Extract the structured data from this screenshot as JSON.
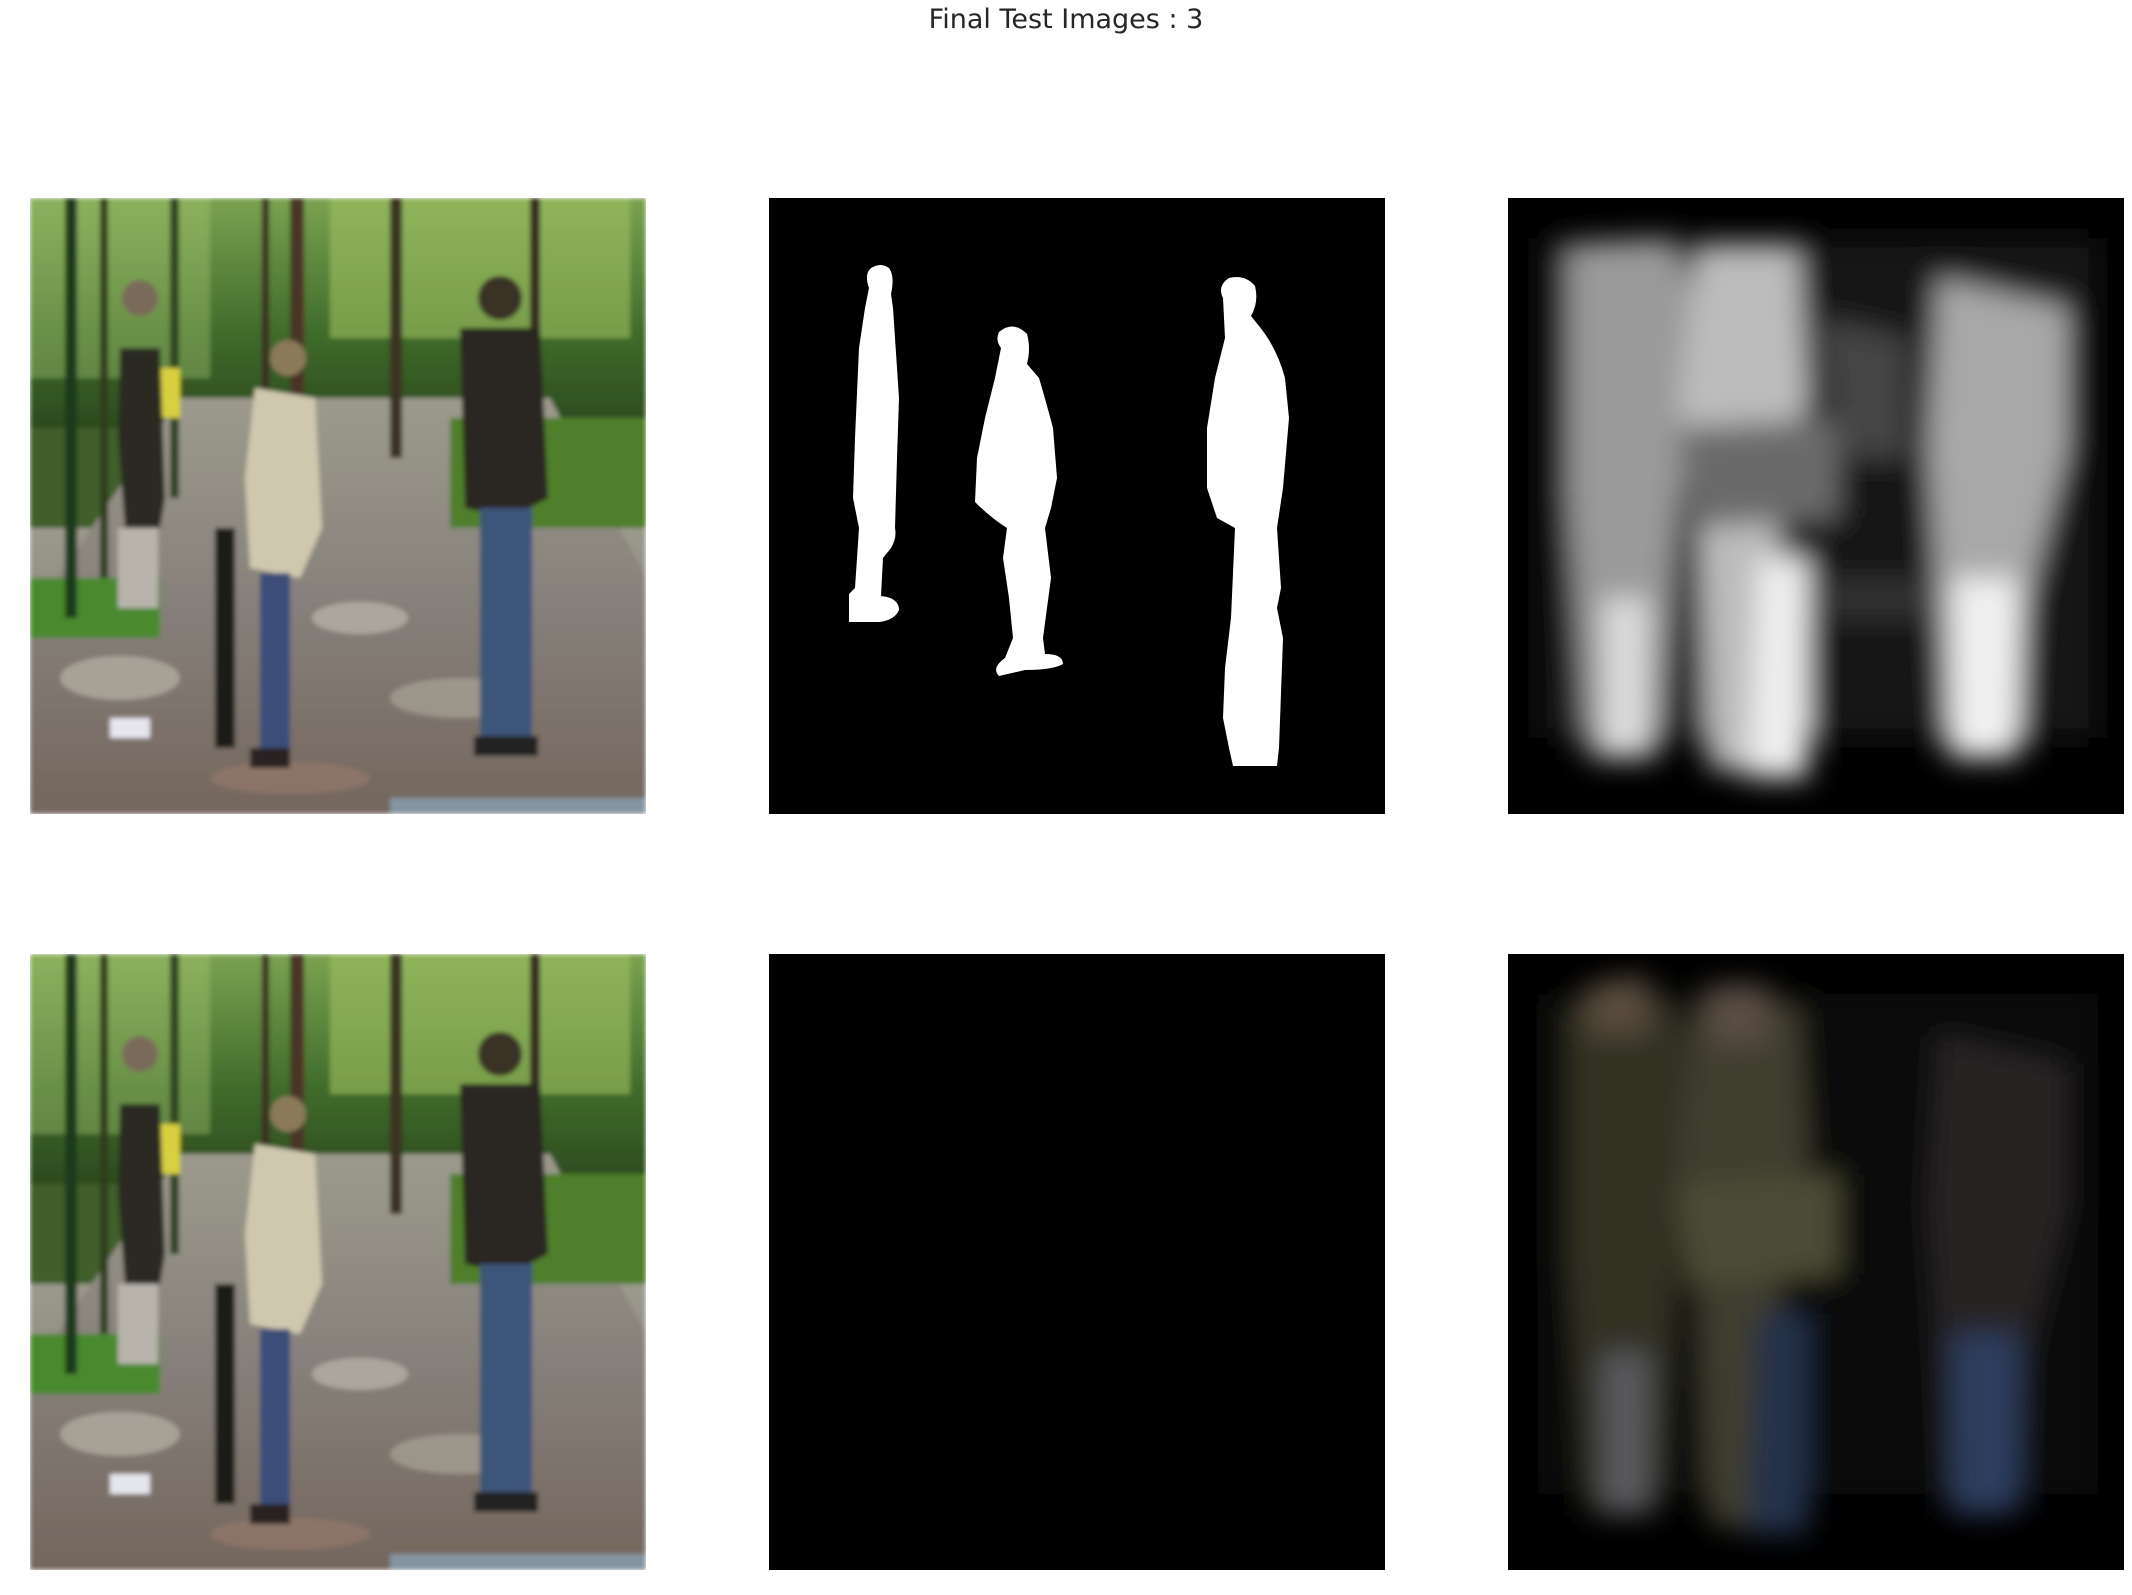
{
  "figure": {
    "title": "Final Test Images : 3"
  },
  "panels": [
    {
      "row": 1,
      "col": 1,
      "content": "photo"
    },
    {
      "row": 1,
      "col": 2,
      "content": "mask"
    },
    {
      "row": 1,
      "col": 3,
      "content": "predicted-mask"
    },
    {
      "row": 2,
      "col": 1,
      "content": "photo"
    },
    {
      "row": 2,
      "col": 2,
      "content": "masked-photo"
    },
    {
      "row": 2,
      "col": 3,
      "content": "predicted-masked-photo"
    }
  ],
  "colors": {
    "background": "#ffffff",
    "foliage": "#4e7a34",
    "path": "#8a8478",
    "mask_fg": "#ffffff",
    "mask_bg": "#000000"
  }
}
